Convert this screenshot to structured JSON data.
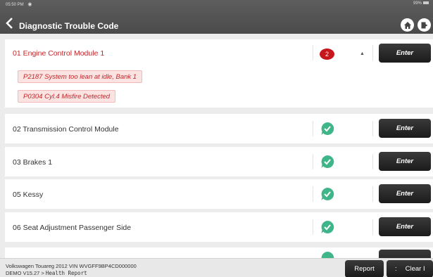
{
  "status": {
    "time": "05:50 PM",
    "battery": "99%"
  },
  "header": {
    "title": "Diagnostic Trouble Code",
    "back_icon": "chevron-left-icon",
    "home_icon": "home-icon",
    "exit_icon": "exit-icon"
  },
  "modules": [
    {
      "name": "01 Engine Control Module 1",
      "status": "fault",
      "fault_count": "2",
      "expanded": true,
      "codes": [
        "P2187 System too lean at idle, Bank 1",
        "P0304 Cyl.4 Misfire Detected"
      ],
      "enter_label": "Enter"
    },
    {
      "name": "02 Transmission Control Module",
      "status": "ok",
      "enter_label": "Enter"
    },
    {
      "name": "03 Brakes 1",
      "status": "ok",
      "enter_label": "Enter"
    },
    {
      "name": "05 Kessy",
      "status": "ok",
      "enter_label": "Enter"
    },
    {
      "name": "06 Seat Adjustment Passenger Side",
      "status": "ok",
      "enter_label": "Enter"
    }
  ],
  "footer": {
    "vehicle": "Volkswagen  Touareg  2012  VIN  WVGFF9BP4CD000000",
    "version": "DEMO V15.27 > ",
    "path": "Health Report",
    "report_label": "Report",
    "clear_glyph": ":",
    "clear_label": "Clear I"
  },
  "colors": {
    "fault": "#c0282b",
    "ok": "#3fb58a",
    "header": "#555555"
  }
}
